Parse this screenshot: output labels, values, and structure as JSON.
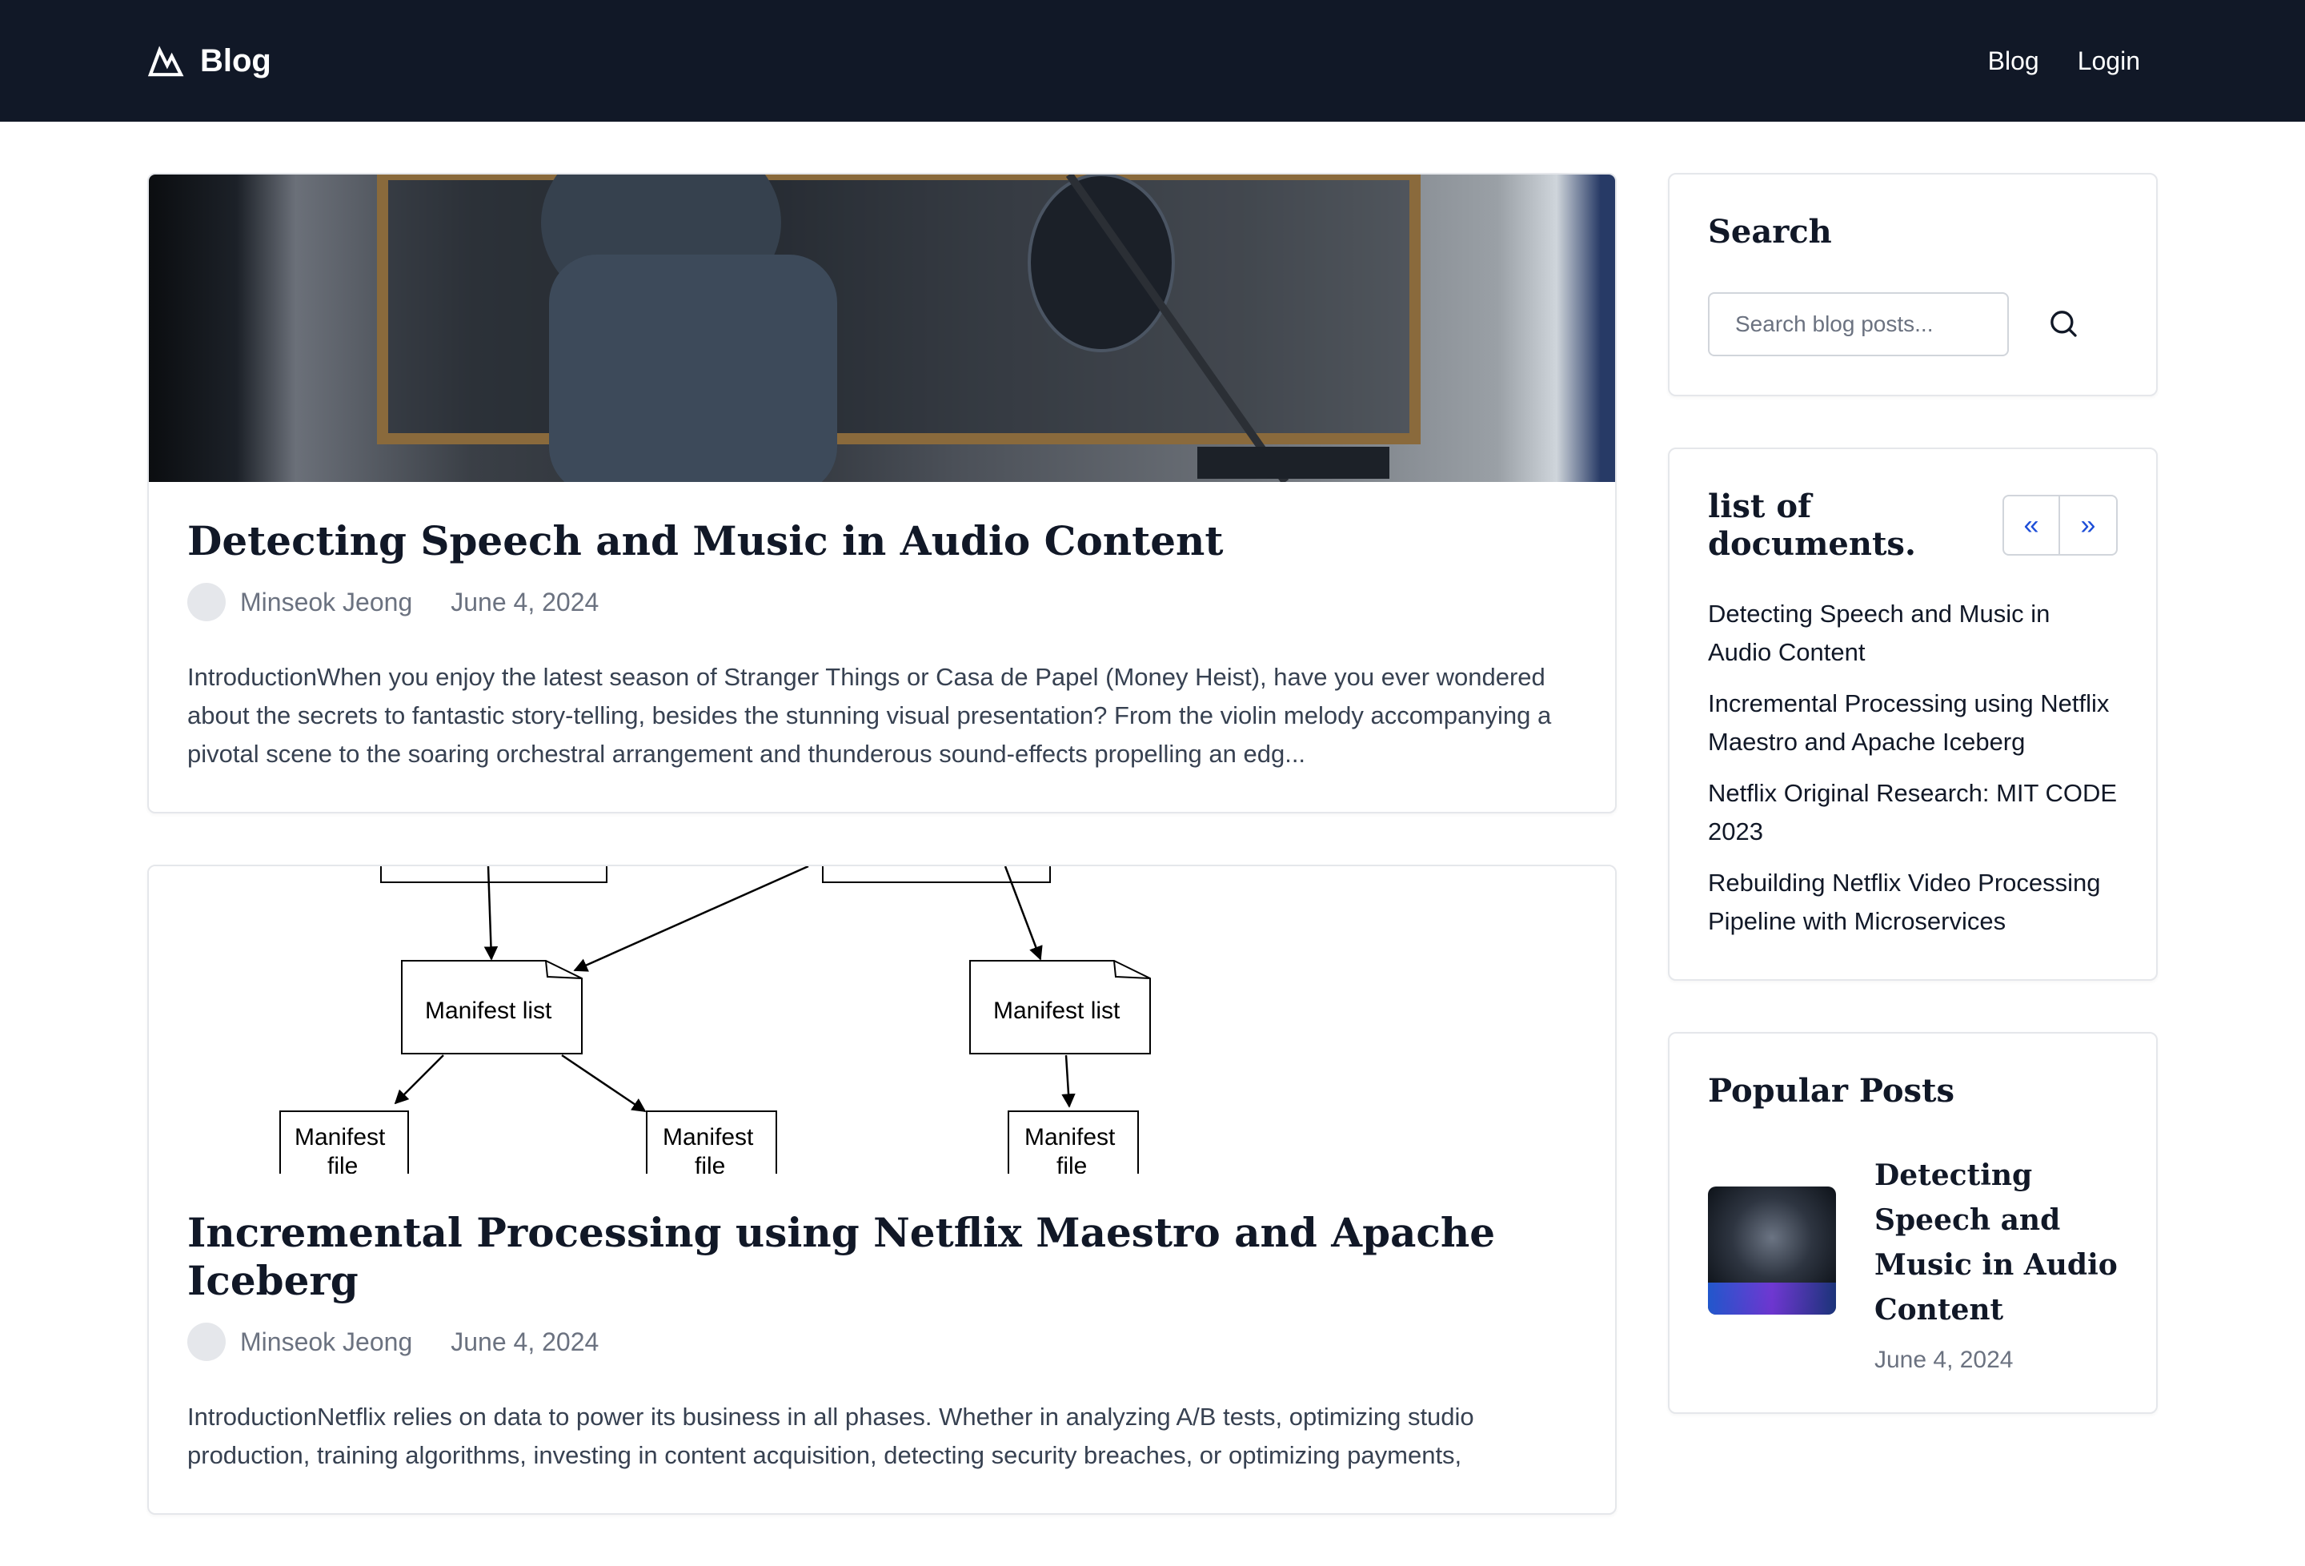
{
  "navbar": {
    "brand": "Blog",
    "links": [
      "Blog",
      "Login"
    ]
  },
  "posts": [
    {
      "title": "Detecting Speech and Music in Audio Content",
      "author": "Minseok Jeong",
      "date": "June 4, 2024",
      "excerpt": "IntroductionWhen you enjoy the latest season of Stranger Things or Casa de Papel (Money Heist), have you ever wondered about the secrets to fantastic story-telling, besides the stunning visual presentation? From the violin melody accompanying a pivotal scene to the soaring orchestral arrangement and thunderous sound-effects propelling an edg..."
    },
    {
      "title": "Incremental Processing using Netflix Maestro and Apache Iceberg",
      "author": "Minseok Jeong",
      "date": "June 4, 2024",
      "excerpt": "IntroductionNetflix relies on data to power its business in all phases. Whether in analyzing A/B tests, optimizing studio production, training algorithms, investing in content acquisition, detecting security breaches, or optimizing payments,",
      "diagram": {
        "manifest_list_1": "Manifest list",
        "manifest_list_2": "Manifest list",
        "manifest_file": "Manifest",
        "manifest_file_2": "file"
      }
    }
  ],
  "search": {
    "title": "Search",
    "placeholder": "Search blog posts..."
  },
  "documents": {
    "title": "list of documents.",
    "prev": "«",
    "next": "»",
    "items": [
      "Detecting Speech and Music in Audio Content",
      "Incremental Processing using Netflix Maestro and Apache Iceberg",
      "Netflix Original Research: MIT CODE 2023",
      "Rebuilding Netflix Video Processing Pipeline with Microservices"
    ]
  },
  "popular": {
    "title": "Popular Posts",
    "items": [
      {
        "title": "Detecting Speech and Music in Audio Content",
        "date": "June 4, 2024"
      }
    ]
  }
}
